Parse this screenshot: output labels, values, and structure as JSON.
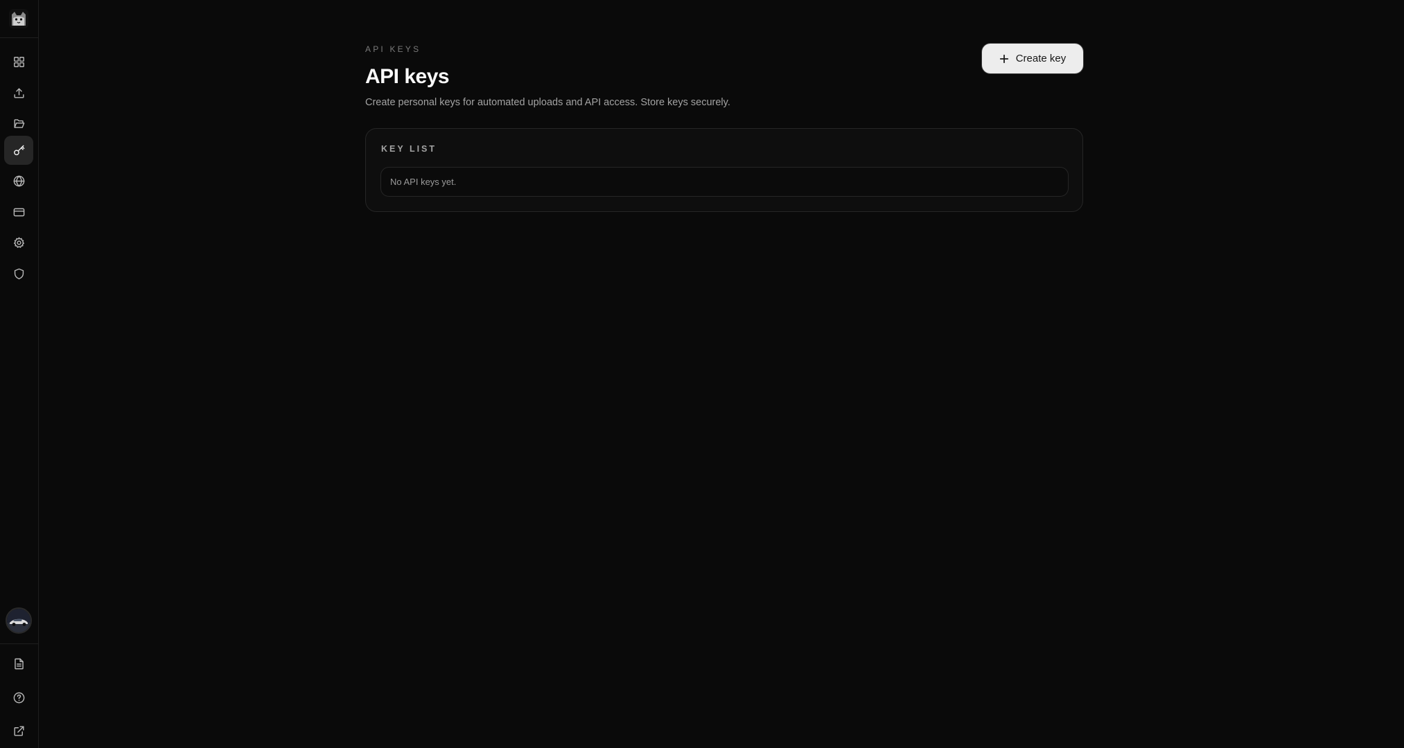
{
  "sidebar": {
    "logo": "cat-logo-icon",
    "items": [
      {
        "name": "dashboard",
        "icon": "grid-icon",
        "active": false
      },
      {
        "name": "upload",
        "icon": "upload-icon",
        "active": false
      },
      {
        "name": "files",
        "icon": "folder-open-icon",
        "active": false
      },
      {
        "name": "api-keys",
        "icon": "key-icon",
        "active": true
      },
      {
        "name": "domains",
        "icon": "globe-icon",
        "active": false
      },
      {
        "name": "billing",
        "icon": "credit-card-icon",
        "active": false
      },
      {
        "name": "settings",
        "icon": "gear-icon",
        "active": false
      },
      {
        "name": "security",
        "icon": "shield-icon",
        "active": false
      }
    ],
    "bottom_items": [
      {
        "name": "docs",
        "icon": "document-icon"
      },
      {
        "name": "help",
        "icon": "help-circle-icon"
      },
      {
        "name": "external",
        "icon": "external-link-icon"
      }
    ]
  },
  "header": {
    "eyebrow": "API KEYS",
    "title": "API keys",
    "description": "Create personal keys for automated uploads and API access. Store keys securely.",
    "create_label": "Create key"
  },
  "key_list": {
    "title": "KEY LIST",
    "empty_text": "No API keys yet."
  },
  "colors": {
    "background": "#0a0a0a",
    "card": "#0e0e0e",
    "border": "#262626",
    "button": "#ededed",
    "active_nav": "#262626"
  }
}
